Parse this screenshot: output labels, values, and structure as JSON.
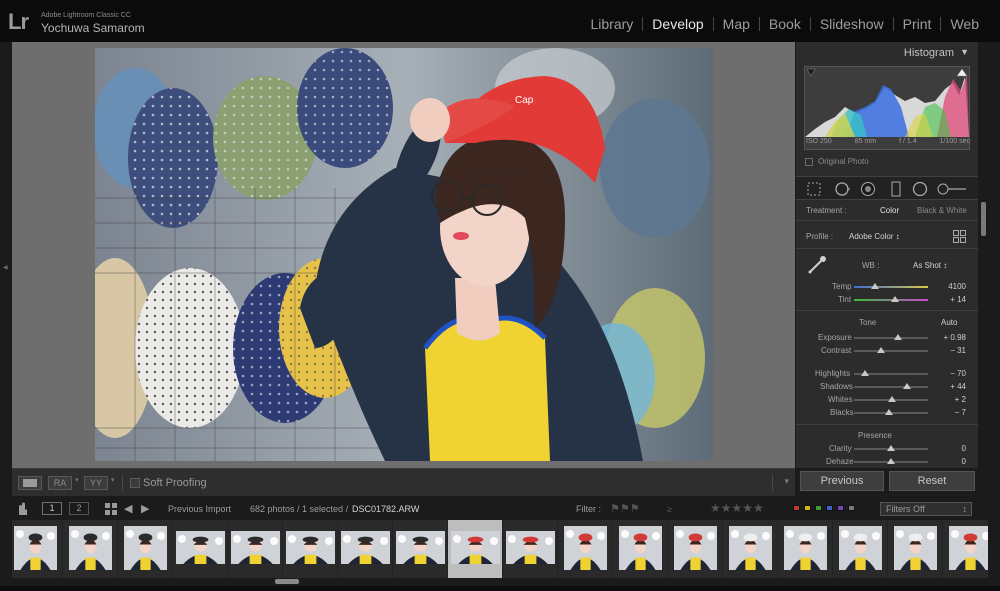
{
  "app": {
    "logo": "Lr",
    "title": "Adobe Lightroom Classic CC",
    "user": "Yochuwa Samarom"
  },
  "modules": [
    {
      "label": "Library",
      "active": false
    },
    {
      "label": "Develop",
      "active": true
    },
    {
      "label": "Map",
      "active": false
    },
    {
      "label": "Book",
      "active": false
    },
    {
      "label": "Slideshow",
      "active": false
    },
    {
      "label": "Print",
      "active": false
    },
    {
      "label": "Web",
      "active": false
    }
  ],
  "toolbar": {
    "view_ra": "RA",
    "view_yy": "YY",
    "soft_proofing": "Soft Proofing"
  },
  "histogram": {
    "title": "Histogram",
    "iso": "ISO 250",
    "focal": "85 mm",
    "aperture": "f / 1.4",
    "shutter": "1/100 sec",
    "original_photo": "Original Photo"
  },
  "basic": {
    "treatment_label": "Treatment :",
    "treatment_color": "Color",
    "treatment_bw": "Black & White",
    "profile_label": "Profile :",
    "profile_value": "Adobe Color ↕",
    "wb_label": "WB :",
    "wb_value": "As Shot ↕",
    "tone_label": "Tone",
    "auto_label": "Auto",
    "presence_label": "Presence",
    "sliders": [
      {
        "label": "Temp",
        "value": "4100",
        "pos": 0.28
      },
      {
        "label": "Tint",
        "value": "+ 14",
        "pos": 0.55
      },
      {
        "label": "Exposure",
        "value": "+ 0.98",
        "pos": 0.6
      },
      {
        "label": "Contrast",
        "value": "− 31",
        "pos": 0.36
      },
      {
        "label": "Highlights",
        "value": "− 70",
        "pos": 0.15
      },
      {
        "label": "Shadows",
        "value": "+ 44",
        "pos": 0.72
      },
      {
        "label": "Whites",
        "value": "+ 2",
        "pos": 0.51
      },
      {
        "label": "Blacks",
        "value": "− 7",
        "pos": 0.47
      },
      {
        "label": "Clarity",
        "value": "0",
        "pos": 0.5
      },
      {
        "label": "Dehaze",
        "value": "0",
        "pos": 0.5
      }
    ]
  },
  "buttons": {
    "previous": "Previous",
    "reset": "Reset"
  },
  "filmstrip": {
    "page1": "1",
    "page2": "2",
    "source": "Previous Import",
    "count": "682 photos / 1 selected /",
    "filename": "DSC01782.ARW",
    "filter_label": "Filter :",
    "filters_off": "Filters Off",
    "stars": "★★★★★",
    "color_labels": [
      "#c0392b",
      "#d4b418",
      "#3f9b3a",
      "#3a64c4",
      "#7a45b0",
      "#7a7a7a"
    ],
    "thumbs": [
      {
        "type": "portrait",
        "cap": "dark"
      },
      {
        "type": "portrait",
        "cap": "dark"
      },
      {
        "type": "portrait",
        "cap": "dark"
      },
      {
        "type": "landscape",
        "cap": "dark"
      },
      {
        "type": "landscape",
        "cap": "dark"
      },
      {
        "type": "landscape",
        "cap": "dark"
      },
      {
        "type": "landscape",
        "cap": "dark"
      },
      {
        "type": "landscape",
        "cap": "dark"
      },
      {
        "type": "landscape",
        "cap": "red",
        "selected": true
      },
      {
        "type": "landscape",
        "cap": "red"
      },
      {
        "type": "portrait",
        "cap": "red"
      },
      {
        "type": "portrait",
        "cap": "red"
      },
      {
        "type": "portrait",
        "cap": "red"
      },
      {
        "type": "portrait",
        "cap": "white"
      },
      {
        "type": "portrait",
        "cap": "white"
      },
      {
        "type": "portrait",
        "cap": "white"
      },
      {
        "type": "portrait",
        "cap": "white"
      },
      {
        "type": "portrait",
        "cap": "red"
      }
    ]
  }
}
